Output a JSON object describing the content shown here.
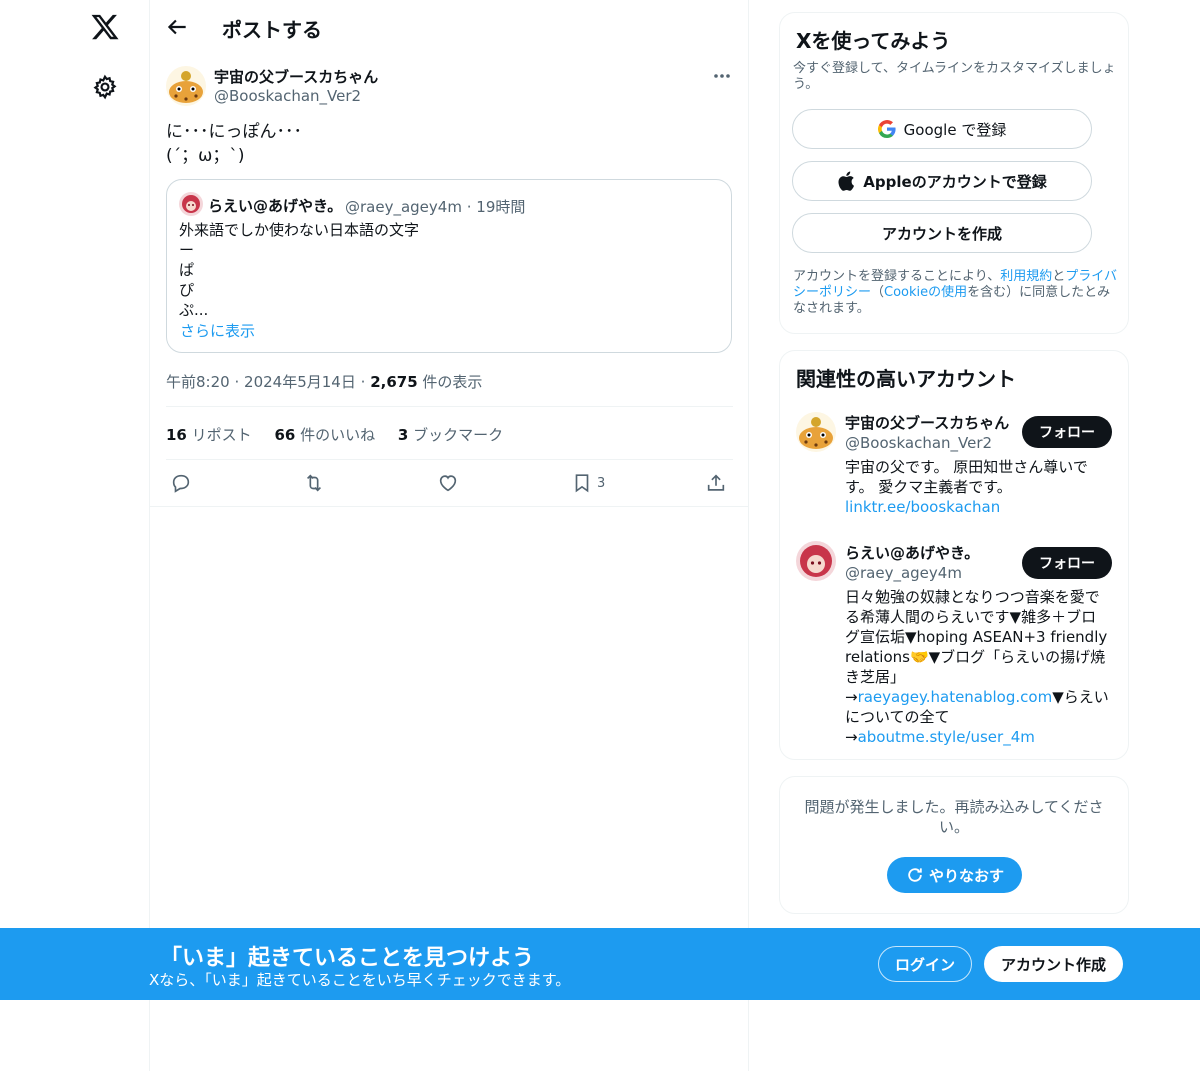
{
  "topbar": {
    "title": "ポストする"
  },
  "post": {
    "author_name": "宇宙の父ブースカちゃん",
    "author_handle": "@Booskachan_Ver2",
    "text": "に･･･にっぽん･･･\n(´；ω；`)",
    "quote": {
      "name": "らえい@あげやき。",
      "handle": "@raey_agey4m",
      "sep": "·",
      "time": "19時間",
      "text": "外来語でしか使わない日本語の文字\nー\nぱ\nぴ\nぷ...",
      "show_more": "さらに表示"
    },
    "meta": {
      "time": "午前8:20",
      "sep1": "·",
      "date": "2024年5月14日",
      "sep2": "·",
      "views": "2,675",
      "views_label": " 件の表示"
    },
    "stats": {
      "reposts": "16",
      "reposts_label": " リポスト",
      "likes": "66",
      "likes_label": " 件のいいね",
      "bookmarks": "3",
      "bookmarks_label": " ブックマーク"
    },
    "actions": {
      "bookmark_count": "3"
    }
  },
  "signup": {
    "title": "Xを使ってみよう",
    "subtitle": "今すぐ登録して、タイムラインをカスタマイズしましょう。",
    "google_label": "Google で登録",
    "apple_label": "Appleのアカウントで登録",
    "create_label": "アカウントを作成",
    "terms_pre": "アカウントを登録することにより、",
    "terms_link": "利用規約",
    "terms_and": "と",
    "privacy_link": "プライバシーポリシー",
    "terms_mid": "（",
    "cookie_link": "Cookieの使用",
    "terms_post": "を含む）に同意したとみなされます。"
  },
  "related": {
    "title": "関連性の高いアカウント",
    "follow_label": "フォロー",
    "accounts": [
      {
        "name": "宇宙の父ブースカちゃん",
        "handle": "@Booskachan_Ver2",
        "bio": "宇宙の父です。 原田知世さん尊いです。 愛クマ主義者です。",
        "link": "linktr.ee/booskachan"
      },
      {
        "name": "らえい@あげやき。",
        "handle": "@raey_agey4m",
        "bio1": "日々勉強の奴隷となりつつ音楽を愛でる希薄人間のらえいです▼雑多＋ブログ宣伝垢▼hoping ASEAN+3 friendly relations🤝▼ブログ「らえいの揚げ焼き芝居」",
        "arrow1": "→",
        "link1": "raeyagey.hatenablog.com",
        "bio2": "▼らえいについての全て",
        "arrow2": "→",
        "link2": "aboutme.style/user_4m"
      }
    ]
  },
  "error_card": {
    "message": "問題が発生しました。再読み込みしてください。",
    "retry_label": "やりなおす"
  },
  "banner": {
    "title": "「いま」起きていることを見つけよう",
    "subtitle": "Xなら、「いま」起きていることをいち早くチェックできます。",
    "login_label": "ログイン",
    "create_label": "アカウント作成"
  },
  "colors": {
    "accent": "#1d9bf0",
    "text": "#0f1419",
    "secondary": "#536471",
    "border": "#cfd9de"
  }
}
